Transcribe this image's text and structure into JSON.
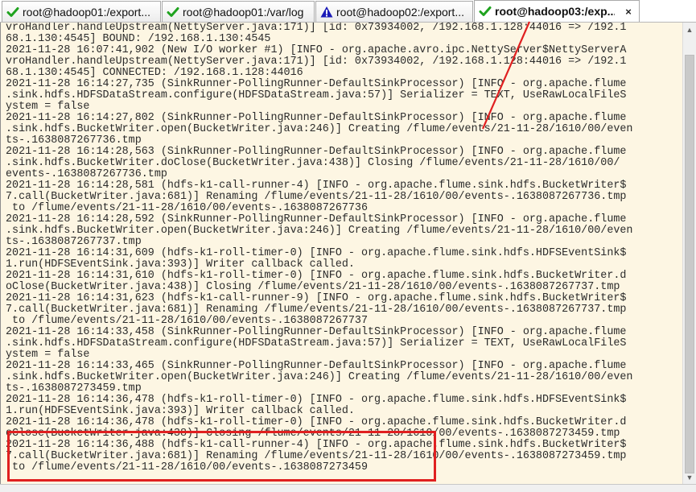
{
  "tabs": [
    {
      "label": "root@hadoop01:/export...",
      "icon": "green-check-icon",
      "active": false
    },
    {
      "label": "root@hadoop01:/var/log",
      "icon": "green-check-icon",
      "active": false
    },
    {
      "label": "root@hadoop02:/export...",
      "icon": "warning-icon",
      "active": false
    },
    {
      "label": "root@hadoop03:/exp...",
      "icon": "green-check-icon",
      "active": true,
      "close": "×"
    }
  ],
  "terminal": {
    "lines": [
      "vroHandler.handleUpstream(NettyServer.java:171)] [id: 0x73934002, /192.168.1.128:44016 => /192.1",
      "68.1.130:4545] BOUND: /192.168.1.130:4545",
      "2021-11-28 16:07:41,902 (New I/O worker #1) [INFO - org.apache.avro.ipc.NettyServer$NettyServerA",
      "vroHandler.handleUpstream(NettyServer.java:171)] [id: 0x73934002, /192.168.1.128:44016 => /192.1",
      "68.1.130:4545] CONNECTED: /192.168.1.128:44016",
      "2021-11-28 16:14:27,735 (SinkRunner-PollingRunner-DefaultSinkProcessor) [INFO - org.apache.flume",
      ".sink.hdfs.HDFSDataStream.configure(HDFSDataStream.java:57)] Serializer = TEXT, UseRawLocalFileS",
      "ystem = false",
      "2021-11-28 16:14:27,802 (SinkRunner-PollingRunner-DefaultSinkProcessor) [INFO - org.apache.flume",
      ".sink.hdfs.BucketWriter.open(BucketWriter.java:246)] Creating /flume/events/21-11-28/1610/00/even",
      "ts-.1638087267736.tmp",
      "2021-11-28 16:14:28,563 (SinkRunner-PollingRunner-DefaultSinkProcessor) [INFO - org.apache.flume",
      ".sink.hdfs.BucketWriter.doClose(BucketWriter.java:438)] Closing /flume/events/21-11-28/1610/00/",
      "events-.1638087267736.tmp",
      "2021-11-28 16:14:28,581 (hdfs-k1-call-runner-4) [INFO - org.apache.flume.sink.hdfs.BucketWriter$",
      "7.call(BucketWriter.java:681)] Renaming /flume/events/21-11-28/1610/00/events-.1638087267736.tmp",
      " to /flume/events/21-11-28/1610/00/events-.1638087267736",
      "2021-11-28 16:14:28,592 (SinkRunner-PollingRunner-DefaultSinkProcessor) [INFO - org.apache.flume",
      ".sink.hdfs.BucketWriter.open(BucketWriter.java:246)] Creating /flume/events/21-11-28/1610/00/even",
      "ts-.1638087267737.tmp",
      "2021-11-28 16:14:31,609 (hdfs-k1-roll-timer-0) [INFO - org.apache.flume.sink.hdfs.HDFSEventSink$",
      "1.run(HDFSEventSink.java:393)] Writer callback called.",
      "2021-11-28 16:14:31,610 (hdfs-k1-roll-timer-0) [INFO - org.apache.flume.sink.hdfs.BucketWriter.d",
      "oClose(BucketWriter.java:438)] Closing /flume/events/21-11-28/1610/00/events-.1638087267737.tmp",
      "2021-11-28 16:14:31,623 (hdfs-k1-call-runner-9) [INFO - org.apache.flume.sink.hdfs.BucketWriter$",
      "7.call(BucketWriter.java:681)] Renaming /flume/events/21-11-28/1610/00/events-.1638087267737.tmp",
      " to /flume/events/21-11-28/1610/00/events-.1638087267737",
      "2021-11-28 16:14:33,458 (SinkRunner-PollingRunner-DefaultSinkProcessor) [INFO - org.apache.flume",
      ".sink.hdfs.HDFSDataStream.configure(HDFSDataStream.java:57)] Serializer = TEXT, UseRawLocalFileS",
      "ystem = false",
      "2021-11-28 16:14:33,465 (SinkRunner-PollingRunner-DefaultSinkProcessor) [INFO - org.apache.flume",
      ".sink.hdfs.BucketWriter.open(BucketWriter.java:246)] Creating /flume/events/21-11-28/1610/00/even",
      "ts-.1638087273459.tmp",
      "2021-11-28 16:14:36,478 (hdfs-k1-roll-timer-0) [INFO - org.apache.flume.sink.hdfs.HDFSEventSink$",
      "1.run(HDFSEventSink.java:393)] Writer callback called.",
      "2021-11-28 16:14:36,478 (hdfs-k1-roll-timer-0) [INFO - org.apache.flume.sink.hdfs.BucketWriter.d",
      "oClose(BucketWriter.java:438)] Closing /flume/events/21-11-28/1610/00/events-.1638087273459.tmp",
      "2021-11-28 16:14:36,488 (hdfs-k1-call-runner-4) [INFO - org.apache.flume.sink.hdfs.BucketWriter$",
      "7.call(BucketWriter.java:681)] Renaming /flume/events/21-11-28/1610/00/events-.1638087273459.tmp",
      " to /flume/events/21-11-28/1610/00/events-.1638087273459"
    ]
  },
  "colors": {
    "terminal_bg": "#fdf6e3",
    "terminal_text": "#2b2b2b",
    "annotation": "#e02020",
    "ok_icon": "#1fa31f",
    "warn_icon": "#1b1bb8"
  }
}
